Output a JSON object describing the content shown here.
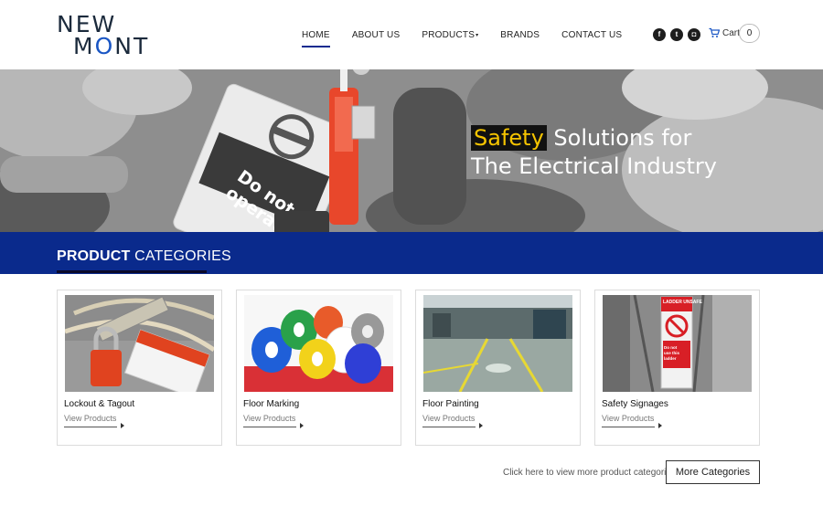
{
  "brand": {
    "line1": "NEW",
    "line2_pre": "M",
    "line2_o": "O",
    "line2_post": "NT"
  },
  "nav": {
    "items": [
      {
        "label": "HOME",
        "active": true
      },
      {
        "label": "ABOUT US"
      },
      {
        "label": "PRODUCTS"
      },
      {
        "label": "BRANDS"
      },
      {
        "label": "CONTACT US"
      }
    ],
    "products_caret": "▾"
  },
  "social": {
    "facebook": "f",
    "twitter": "t",
    "instagram": "◘"
  },
  "cart": {
    "label": "Cart",
    "count": "0"
  },
  "hero": {
    "highlight": "Safety",
    "line1_rest": " Solutions for",
    "line2": "The Electrical Industry",
    "tag_text": "Do not operate",
    "highlight_color": "#f5c400"
  },
  "section": {
    "title_bold": "PRODUCT",
    "title_rest": " CATEGORIES",
    "band_color": "#0a2a8c"
  },
  "categories": [
    {
      "name": "Lockout & Tagout",
      "link": "View Products"
    },
    {
      "name": "Floor Marking",
      "link": "View Products"
    },
    {
      "name": "Floor Painting",
      "link": "View Products"
    },
    {
      "name": "Safety Signages",
      "link": "View Products",
      "sign_top": "LADDER UNSAFE",
      "sign_bottom": "Do not use this ladder"
    }
  ],
  "more": {
    "text": "Click here to view more product categories",
    "button": "More Categories"
  }
}
